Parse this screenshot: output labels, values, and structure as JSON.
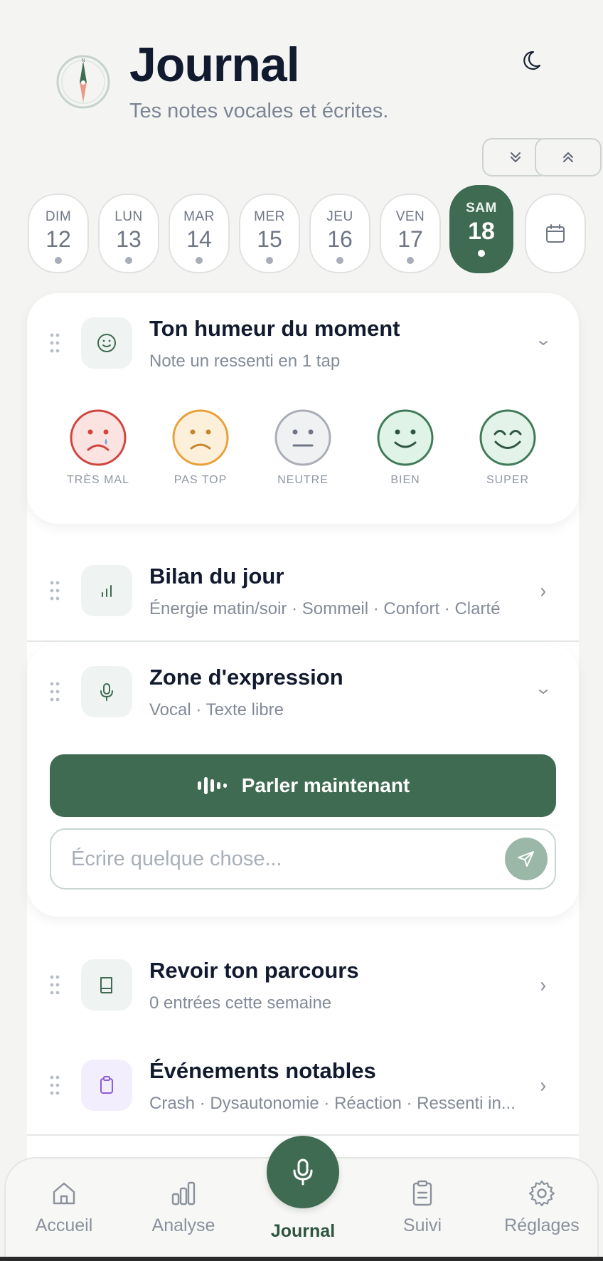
{
  "header": {
    "title": "Journal",
    "subtitle": "Tes notes vocales et écrites.",
    "compass_letter": "N"
  },
  "days": [
    {
      "name": "DIM",
      "num": "12",
      "active": false
    },
    {
      "name": "LUN",
      "num": "13",
      "active": false
    },
    {
      "name": "MAR",
      "num": "14",
      "active": false
    },
    {
      "name": "MER",
      "num": "15",
      "active": false
    },
    {
      "name": "JEU",
      "num": "16",
      "active": false
    },
    {
      "name": "VEN",
      "num": "17",
      "active": false
    },
    {
      "name": "SAM",
      "num": "18",
      "active": true
    }
  ],
  "mood": {
    "title": "Ton humeur du moment",
    "subtitle": "Note un ressenti en 1 tap",
    "options": [
      {
        "label": "TRÈS MAL",
        "color": "#d0443e"
      },
      {
        "label": "PAS TOP",
        "color": "#e8a13a"
      },
      {
        "label": "NEUTRE",
        "color": "#a9adb5"
      },
      {
        "label": "BIEN",
        "color": "#4a9c6c"
      },
      {
        "label": "SUPER",
        "color": "#3f7b58"
      }
    ]
  },
  "bilan": {
    "title": "Bilan du jour",
    "subtitle": "Énergie matin/soir · Sommeil · Confort · Clarté"
  },
  "expression": {
    "title": "Zone d'expression",
    "subtitle": "Vocal · Texte libre",
    "speak_label": "Parler maintenant",
    "write_placeholder": "Écrire quelque chose..."
  },
  "parcours": {
    "title": "Revoir ton parcours",
    "subtitle": "0 entrées cette semaine"
  },
  "evenements": {
    "title": "Événements notables",
    "subtitle": "Crash · Dysautonomie · Réaction · Ressenti in..."
  },
  "nav": {
    "home": "Accueil",
    "analyse": "Analyse",
    "journal": "Journal",
    "suivi": "Suivi",
    "reglages": "Réglages"
  },
  "colors": {
    "accent": "#3f6b52",
    "background": "#f4f5f3"
  }
}
